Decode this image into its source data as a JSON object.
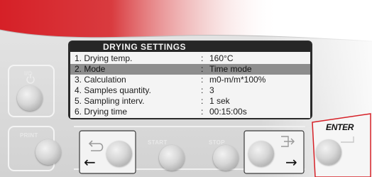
{
  "display": {
    "title": "DRYING SETTINGS",
    "rows": [
      {
        "label": "1. Drying temp.",
        "sep": ":",
        "value": "160°C"
      },
      {
        "label": "2. Mode",
        "sep": ":",
        "value": "Time mode"
      },
      {
        "label": "3. Calculation",
        "sep": ":",
        "value": "m0-m/m*100%"
      },
      {
        "label": "4. Samples quantity.",
        "sep": ":",
        "value": "3"
      },
      {
        "label": "5. Sampling interv.",
        "sep": ":",
        "value": "1 sek"
      },
      {
        "label": "6. Drying time",
        "sep": ":",
        "value": "00:15:00s"
      }
    ],
    "highlighted_row": 2
  },
  "buttons": {
    "power_label": "I/⏻",
    "print_label": "PRINT",
    "start_label": "START",
    "stop_label": "STOP",
    "back_arrow": "←",
    "next_arrow": "→",
    "enter_label": "ENTER"
  },
  "colors": {
    "accent_red": "#d62027",
    "panel": "#dcdcdc",
    "display_dark": "#262626",
    "display_light": "#f4f4f4",
    "highlight": "#8d8d8d"
  },
  "icons": [
    "power-icon",
    "undo-icon",
    "export-icon",
    "enter-arrow-icon"
  ]
}
